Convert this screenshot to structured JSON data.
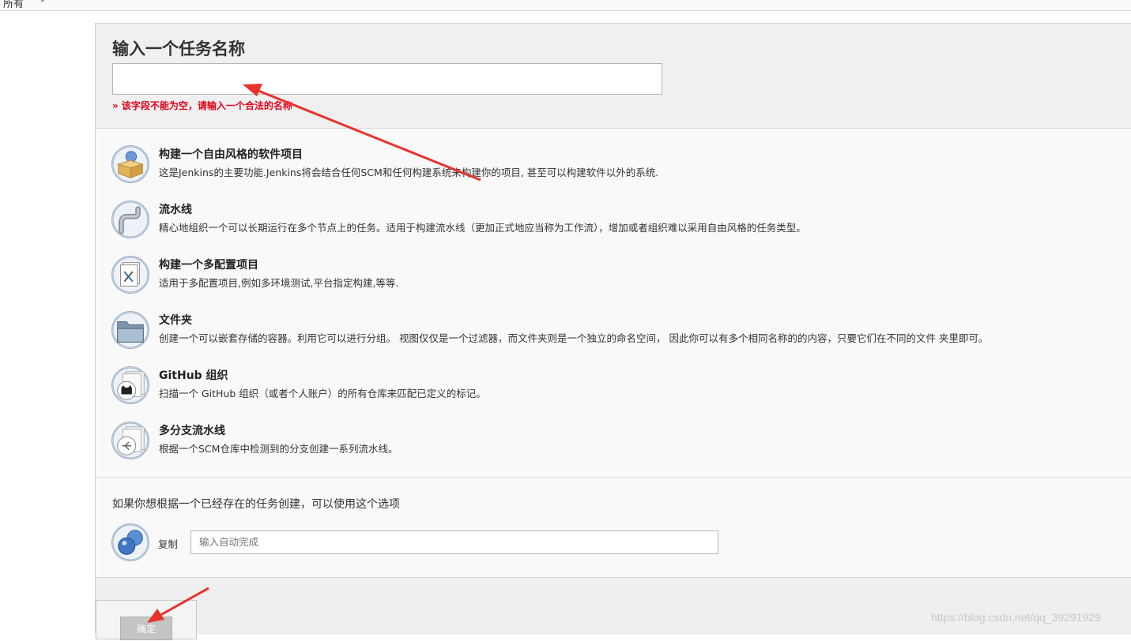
{
  "breadcrumb": {
    "label": "所有",
    "separator": "▸"
  },
  "header": {
    "title": "输入一个任务名称",
    "name_value": "",
    "error": "» 该字段不能为空，请输入一个合法的名称"
  },
  "types": [
    {
      "icon": "freestyle-project-icon",
      "name": "构建一个自由风格的软件项目",
      "desc": "这是Jenkins的主要功能.Jenkins将会结合任何SCM和任何构建系统来构建你的项目, 甚至可以构建软件以外的系统."
    },
    {
      "icon": "pipeline-icon",
      "name": "流水线",
      "desc": "精心地组织一个可以长期运行在多个节点上的任务。适用于构建流水线（更加正式地应当称为工作流），增加或者组织难以采用自由风格的任务类型。"
    },
    {
      "icon": "multi-config-icon",
      "name": "构建一个多配置项目",
      "desc": "适用于多配置项目,例如多环境测试,平台指定构建,等等."
    },
    {
      "icon": "folder-icon",
      "name": "文件夹",
      "desc": "创建一个可以嵌套存储的容器。利用它可以进行分组。 视图仅仅是一个过滤器，而文件夹则是一个独立的命名空间， 因此你可以有多个相同名称的的内容，只要它们在不同的文件 夹里即可。"
    },
    {
      "icon": "github-org-icon",
      "name": "GitHub 组织",
      "desc": "扫描一个 GitHub 组织（或者个人账户）的所有仓库来匹配已定义的标记。"
    },
    {
      "icon": "multibranch-pipeline-icon",
      "name": "多分支流水线",
      "desc": "根据一个SCM仓库中检测到的分支创建一系列流水线。"
    }
  ],
  "copy": {
    "hint": "如果你想根据一个已经存在的任务创建，可以使用这个选项",
    "label": "复制",
    "placeholder": "输入自动完成"
  },
  "footer": {
    "ok_label": "确定"
  },
  "watermark": "https://blog.csdn.net/qq_39291929",
  "annotations": {
    "arrow_color": "#e8322c"
  }
}
